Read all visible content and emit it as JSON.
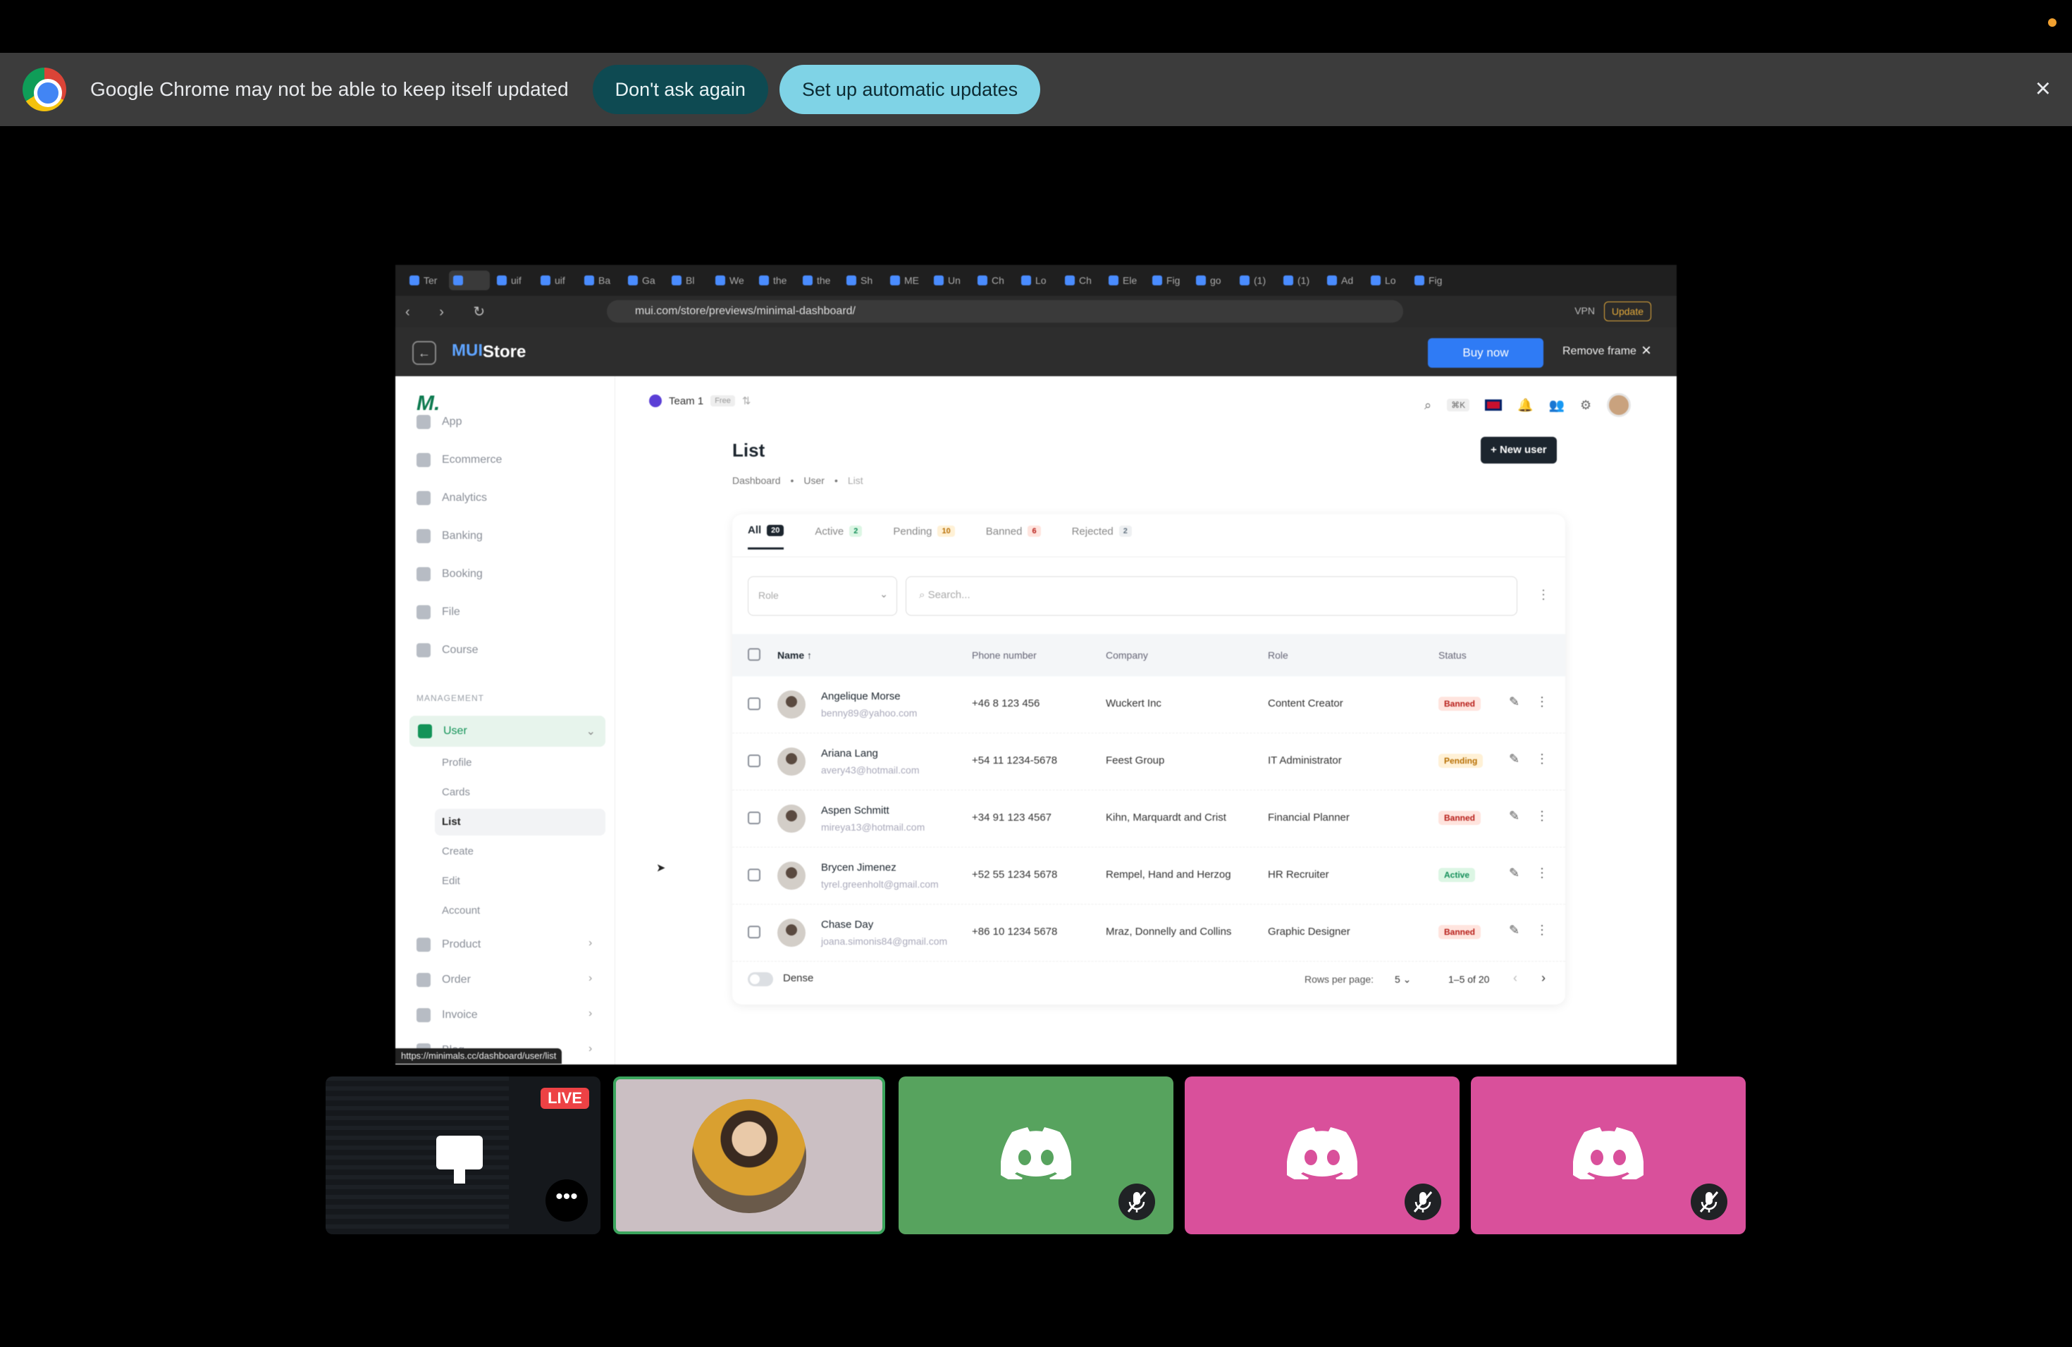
{
  "infobar": {
    "message": "Google Chrome may not be able to keep itself updated",
    "dont_ask_label": "Don't ask again",
    "setup_label": "Set up automatic updates",
    "close_glyph": "×"
  },
  "shared_screen": {
    "tabs": [
      "Ter",
      "",
      "uif",
      "uif",
      "Ba",
      "Ga",
      "Bl",
      "We",
      "the",
      "the",
      "Sh",
      "ME",
      "Un",
      "Ch",
      "Lo",
      "Ch",
      "Ele",
      "Fig",
      "go",
      "(1)",
      "(1)",
      "Ad",
      "Lo",
      "Fig"
    ],
    "url": "mui.com/store/previews/minimal-dashboard/",
    "vpn_label": "VPN",
    "update_label": "Update",
    "store_title": "Store",
    "buy_now_label": "Buy now",
    "remove_frame_label": "Remove frame",
    "status_url": "https://minimals.cc/dashboard/user/list"
  },
  "dashboard": {
    "logo": "M.",
    "team": {
      "name": "Team 1",
      "plan": "Free"
    },
    "search_shortcut": "⌘K",
    "nav_overview": [
      "App",
      "Ecommerce",
      "Analytics",
      "Banking",
      "Booking",
      "File",
      "Course"
    ],
    "management_label": "MANAGEMENT",
    "nav_user": "User",
    "user_subitems": [
      "Profile",
      "Cards",
      "List",
      "Create",
      "Edit",
      "Account"
    ],
    "nav_more": [
      "Product",
      "Order",
      "Invoice",
      "Blog"
    ],
    "page_title": "List",
    "new_user_label": "New user",
    "breadcrumbs": [
      "Dashboard",
      "User",
      "List"
    ],
    "tabs": [
      {
        "label": "All",
        "count": "20"
      },
      {
        "label": "Active",
        "count": "2"
      },
      {
        "label": "Pending",
        "count": "10"
      },
      {
        "label": "Banned",
        "count": "6"
      },
      {
        "label": "Rejected",
        "count": "2"
      }
    ],
    "role_placeholder": "Role",
    "search_placeholder": "Search...",
    "columns": [
      "Name",
      "Phone number",
      "Company",
      "Role",
      "Status"
    ],
    "rows": [
      {
        "name": "Angelique Morse",
        "email": "benny89@yahoo.com",
        "phone": "+46 8 123 456",
        "company": "Wuckert Inc",
        "role": "Content Creator",
        "status": "Banned"
      },
      {
        "name": "Ariana Lang",
        "email": "avery43@hotmail.com",
        "phone": "+54 11 1234-5678",
        "company": "Feest Group",
        "role": "IT Administrator",
        "status": "Pending"
      },
      {
        "name": "Aspen Schmitt",
        "email": "mireya13@hotmail.com",
        "phone": "+34 91 123 4567",
        "company": "Kihn, Marquardt and Crist",
        "role": "Financial Planner",
        "status": "Banned"
      },
      {
        "name": "Brycen Jimenez",
        "email": "tyrel.greenholt@gmail.com",
        "phone": "+52 55 1234 5678",
        "company": "Rempel, Hand and Herzog",
        "role": "HR Recruiter",
        "status": "Active"
      },
      {
        "name": "Chase Day",
        "email": "joana.simonis84@gmail.com",
        "phone": "+86 10 1234 5678",
        "company": "Mraz, Donnelly and Collins",
        "role": "Graphic Designer",
        "status": "Banned"
      }
    ],
    "dense_label": "Dense",
    "rows_per_page_label": "Rows per page:",
    "rows_per_page_value": "5",
    "page_range": "1–5 of 20"
  },
  "participants": {
    "live_label": "LIVE"
  },
  "colors": {
    "discord_green": "#57a35e",
    "discord_pink": "#d9509b",
    "speaking_border": "#3ba55d",
    "chrome_button_dark": "#0e4a52",
    "chrome_button_light": "#7fd3e6"
  }
}
